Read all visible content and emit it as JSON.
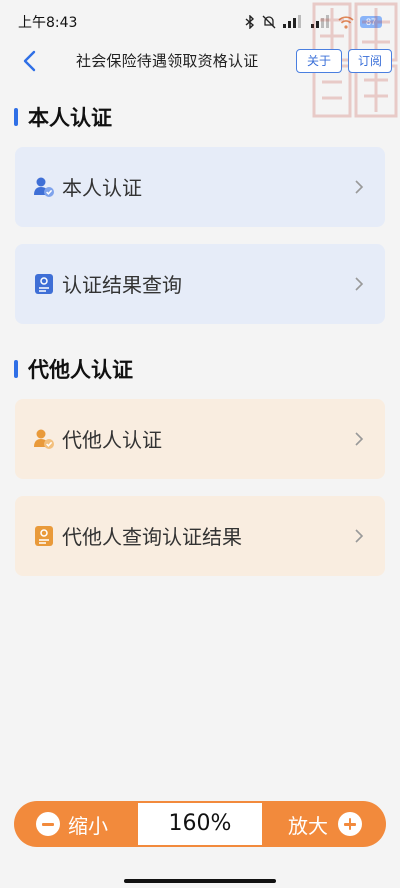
{
  "status_bar": {
    "time": "上午8:43",
    "battery": "87",
    "icons": [
      "bluetooth-icon",
      "bell-muted-icon",
      "signal-icon",
      "wifi-icon",
      "battery-icon"
    ]
  },
  "header": {
    "title": "社会保险待遇领取资格认证",
    "about_label": "关于",
    "subscribe_label": "订阅"
  },
  "sections": [
    {
      "title": "本人认证",
      "items": [
        {
          "label": "本人认证",
          "icon": "user-check-icon"
        },
        {
          "label": "认证结果查询",
          "icon": "document-user-icon"
        }
      ]
    },
    {
      "title": "代他人认证",
      "items": [
        {
          "label": "代他人认证",
          "icon": "user-check-icon"
        },
        {
          "label": "代他人查询认证结果",
          "icon": "document-user-icon"
        }
      ]
    }
  ],
  "zoom": {
    "out_label": "缩小",
    "value": "160%",
    "in_label": "放大"
  },
  "colors": {
    "accent_blue": "#2f6fe6",
    "card_blue": "#e6ecf8",
    "card_orange": "#f9ede0",
    "zoom_orange": "#f28a3c"
  }
}
